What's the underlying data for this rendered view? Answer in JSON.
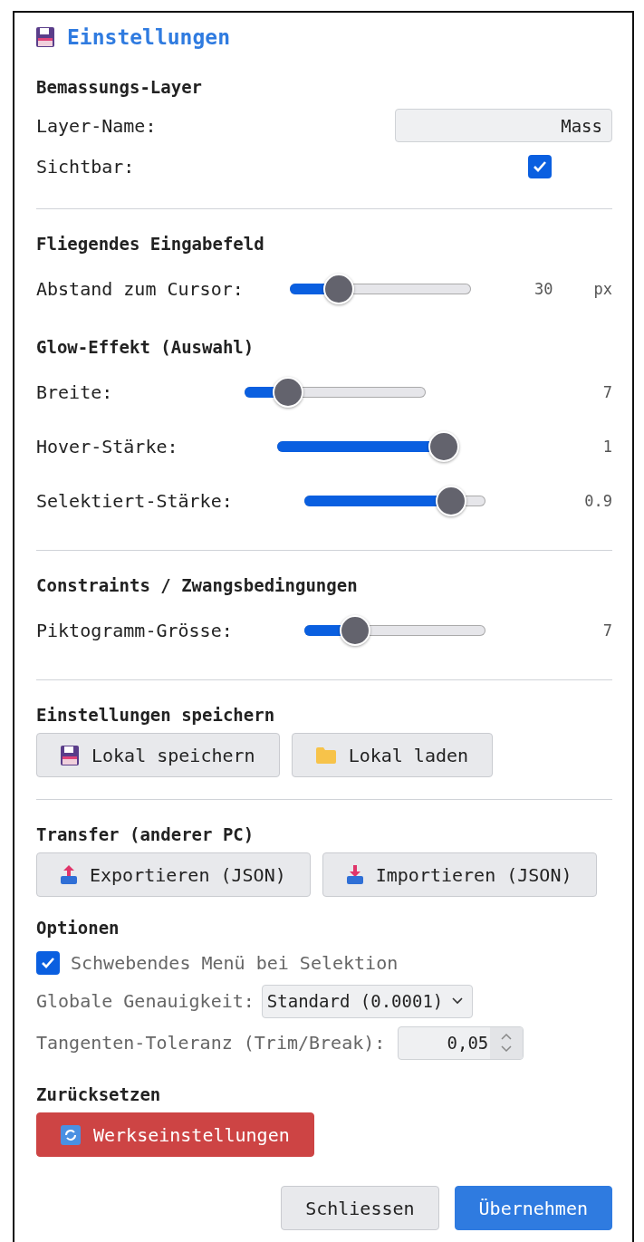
{
  "header": {
    "title": "Einstellungen"
  },
  "groups": [
    {
      "sections": [
        {
          "heading": "Bemassungs-Layer",
          "rows": [
            {
              "kind": "text",
              "label": "Layer-Name:",
              "value": "Mass"
            },
            {
              "kind": "checkbox",
              "label": "Sichtbar:",
              "checked": true
            }
          ]
        }
      ]
    },
    {
      "sections": [
        {
          "heading": "Fliegendes Eingabefeld",
          "rows": [
            {
              "kind": "slider",
              "label": "Abstand zum Cursor:",
              "level": 0.27,
              "reading": "30",
              "unit": "px"
            }
          ]
        },
        {
          "heading": "Glow-Effekt (Auswahl)",
          "rows": [
            {
              "kind": "slider",
              "label": "Breite:",
              "level": 0.24,
              "reading": "7"
            },
            {
              "kind": "slider",
              "label": "Hover-Stärke:",
              "level": 0.92,
              "reading": "1"
            },
            {
              "kind": "slider",
              "label": "Selektiert-Stärke:",
              "level": 0.81,
              "reading": "0.9"
            }
          ]
        }
      ]
    },
    {
      "sections": [
        {
          "heading": "Constraints / Zwangsbedingungen",
          "rows": [
            {
              "kind": "slider",
              "label": "Piktogramm-Grösse:",
              "level": 0.28,
              "reading": "7"
            }
          ]
        }
      ]
    },
    {
      "sections": [
        {
          "heading": "Einstellungen speichern",
          "rows": [
            {
              "kind": "buttons",
              "buttons": [
                {
                  "kind": "save",
                  "label": "Lokal speichern"
                },
                {
                  "kind": "load",
                  "label": "Lokal laden"
                }
              ]
            }
          ]
        }
      ]
    },
    {
      "sections": [
        {
          "heading": "Transfer (anderer PC)",
          "rows": [
            {
              "kind": "buttons",
              "buttons": [
                {
                  "kind": "export",
                  "label": "Exportieren (JSON)"
                },
                {
                  "kind": "import",
                  "label": "Importieren (JSON)"
                }
              ]
            }
          ]
        },
        {
          "heading": "Optionen",
          "rows": [
            {
              "kind": "inline-checkbox",
              "label": "Schwebendes Menü bei Selektion",
              "checked": true
            },
            {
              "kind": "select",
              "label": "Globale Genauigkeit:",
              "value": "Standard (0.0001)"
            },
            {
              "kind": "number",
              "label": "Tangenten-Toleranz (Trim/Break):",
              "value": "0,05"
            }
          ]
        },
        {
          "heading": "Zurücksetzen",
          "rows": [
            {
              "kind": "buttons",
              "buttons": [
                {
                  "kind": "reset",
                  "label": "Werkseinstellungen"
                }
              ]
            }
          ]
        }
      ]
    }
  ],
  "footer": [
    {
      "kind": "cancel",
      "label": "Schliessen"
    },
    {
      "kind": "confirm",
      "label": "Übernehmen"
    }
  ]
}
